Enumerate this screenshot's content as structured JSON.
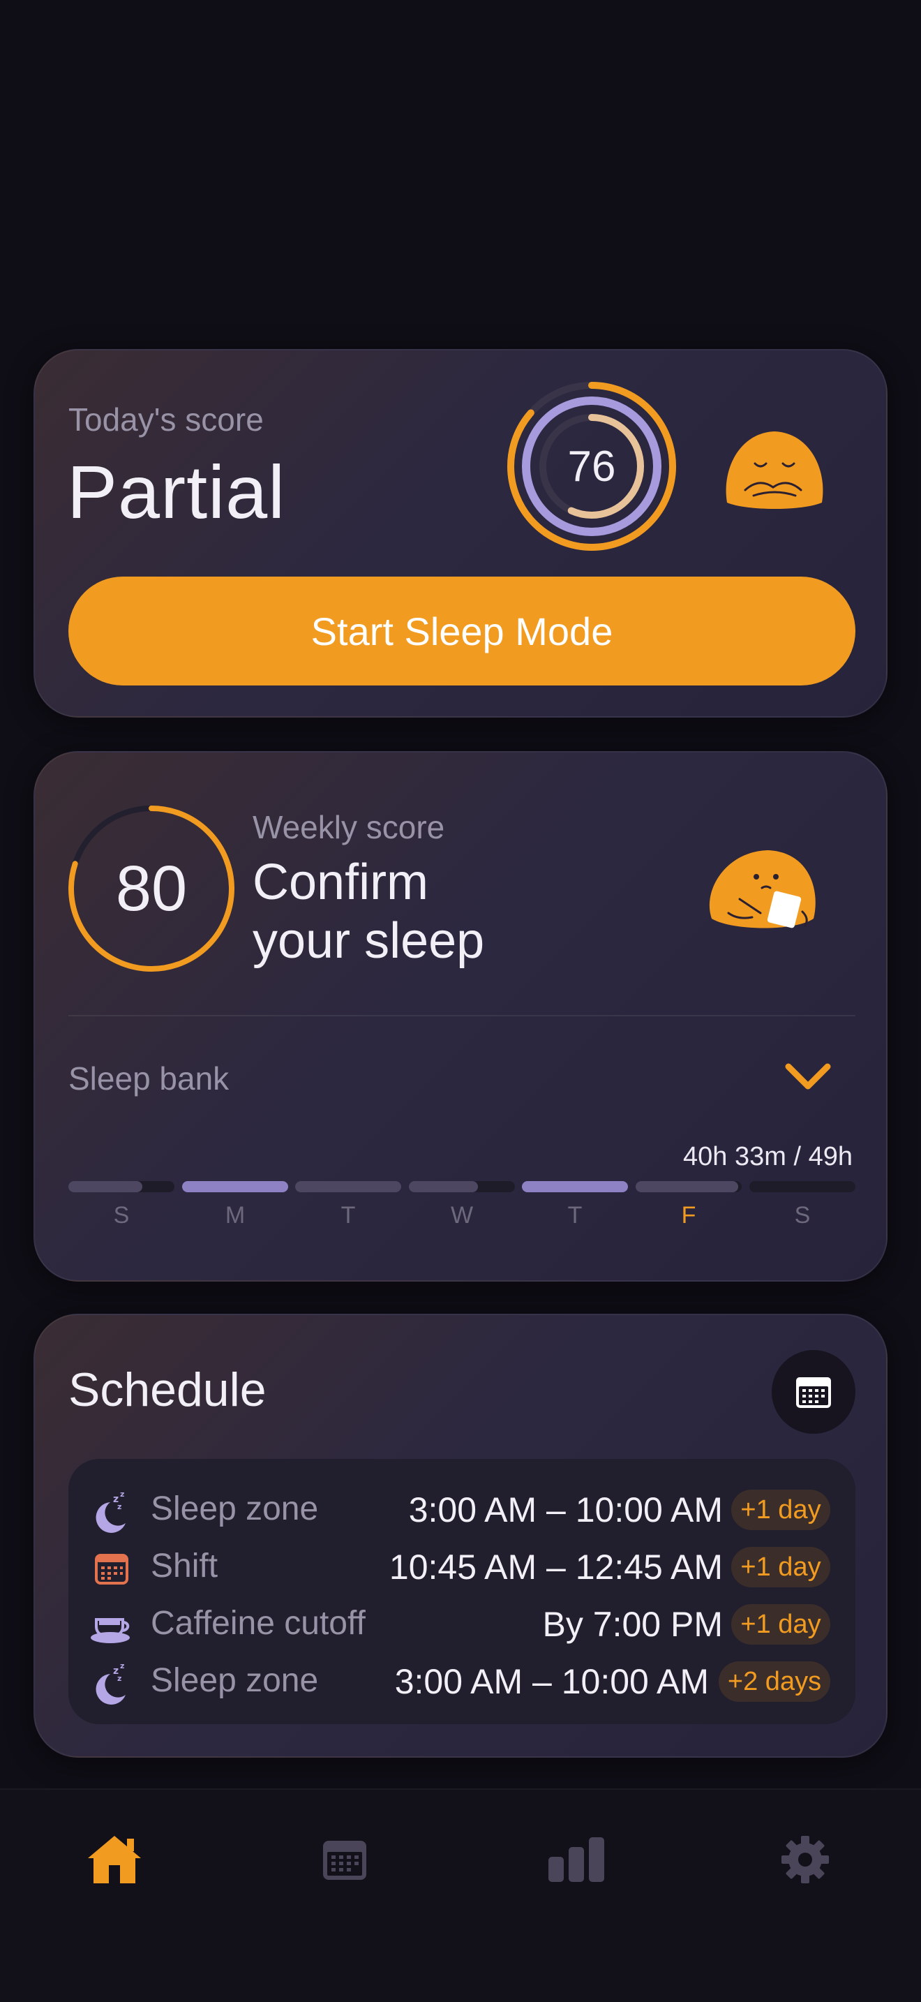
{
  "today": {
    "label": "Today's score",
    "status": "Partial",
    "score": "76",
    "button_label": "Start Sleep Mode"
  },
  "weekly": {
    "score": "80",
    "label": "Weekly score",
    "status_line1": "Confirm",
    "status_line2": "your sleep"
  },
  "sleep_bank": {
    "label": "Sleep bank",
    "total": "40h 33m / 49h",
    "days": [
      {
        "letter": "S",
        "fill": 0.7,
        "highlight": false,
        "today": false
      },
      {
        "letter": "M",
        "fill": 1.0,
        "highlight": true,
        "today": false
      },
      {
        "letter": "T",
        "fill": 1.0,
        "highlight": false,
        "today": false
      },
      {
        "letter": "W",
        "fill": 0.65,
        "highlight": false,
        "today": false
      },
      {
        "letter": "T",
        "fill": 1.0,
        "highlight": true,
        "today": false
      },
      {
        "letter": "F",
        "fill": 0.97,
        "highlight": false,
        "today": true
      },
      {
        "letter": "S",
        "fill": 0.0,
        "highlight": false,
        "today": false
      }
    ]
  },
  "schedule": {
    "title": "Schedule",
    "items": [
      {
        "icon": "sleep-zone-icon",
        "name": "Sleep zone",
        "time": "3:00 AM – 10:00 AM",
        "badge": "+1 day"
      },
      {
        "icon": "shift-calendar-icon",
        "name": "Shift",
        "time": "10:45 AM – 12:45 AM",
        "badge": "+1 day"
      },
      {
        "icon": "coffee-cup-icon",
        "name": "Caffeine cutoff",
        "time": "By 7:00 PM",
        "badge": "+1 day"
      },
      {
        "icon": "sleep-zone-icon",
        "name": "Sleep zone",
        "time": "3:00 AM – 10:00 AM",
        "badge": "+2 days"
      }
    ]
  },
  "nav": {
    "items": [
      {
        "icon": "home-icon",
        "active": true
      },
      {
        "icon": "calendar-icon",
        "active": false
      },
      {
        "icon": "stats-icon",
        "active": false
      },
      {
        "icon": "settings-icon",
        "active": false
      }
    ]
  },
  "colors": {
    "accent": "#f29b21",
    "lavender": "#9d8fd0",
    "muted": "#9893a6",
    "background": "#0f0d15"
  }
}
